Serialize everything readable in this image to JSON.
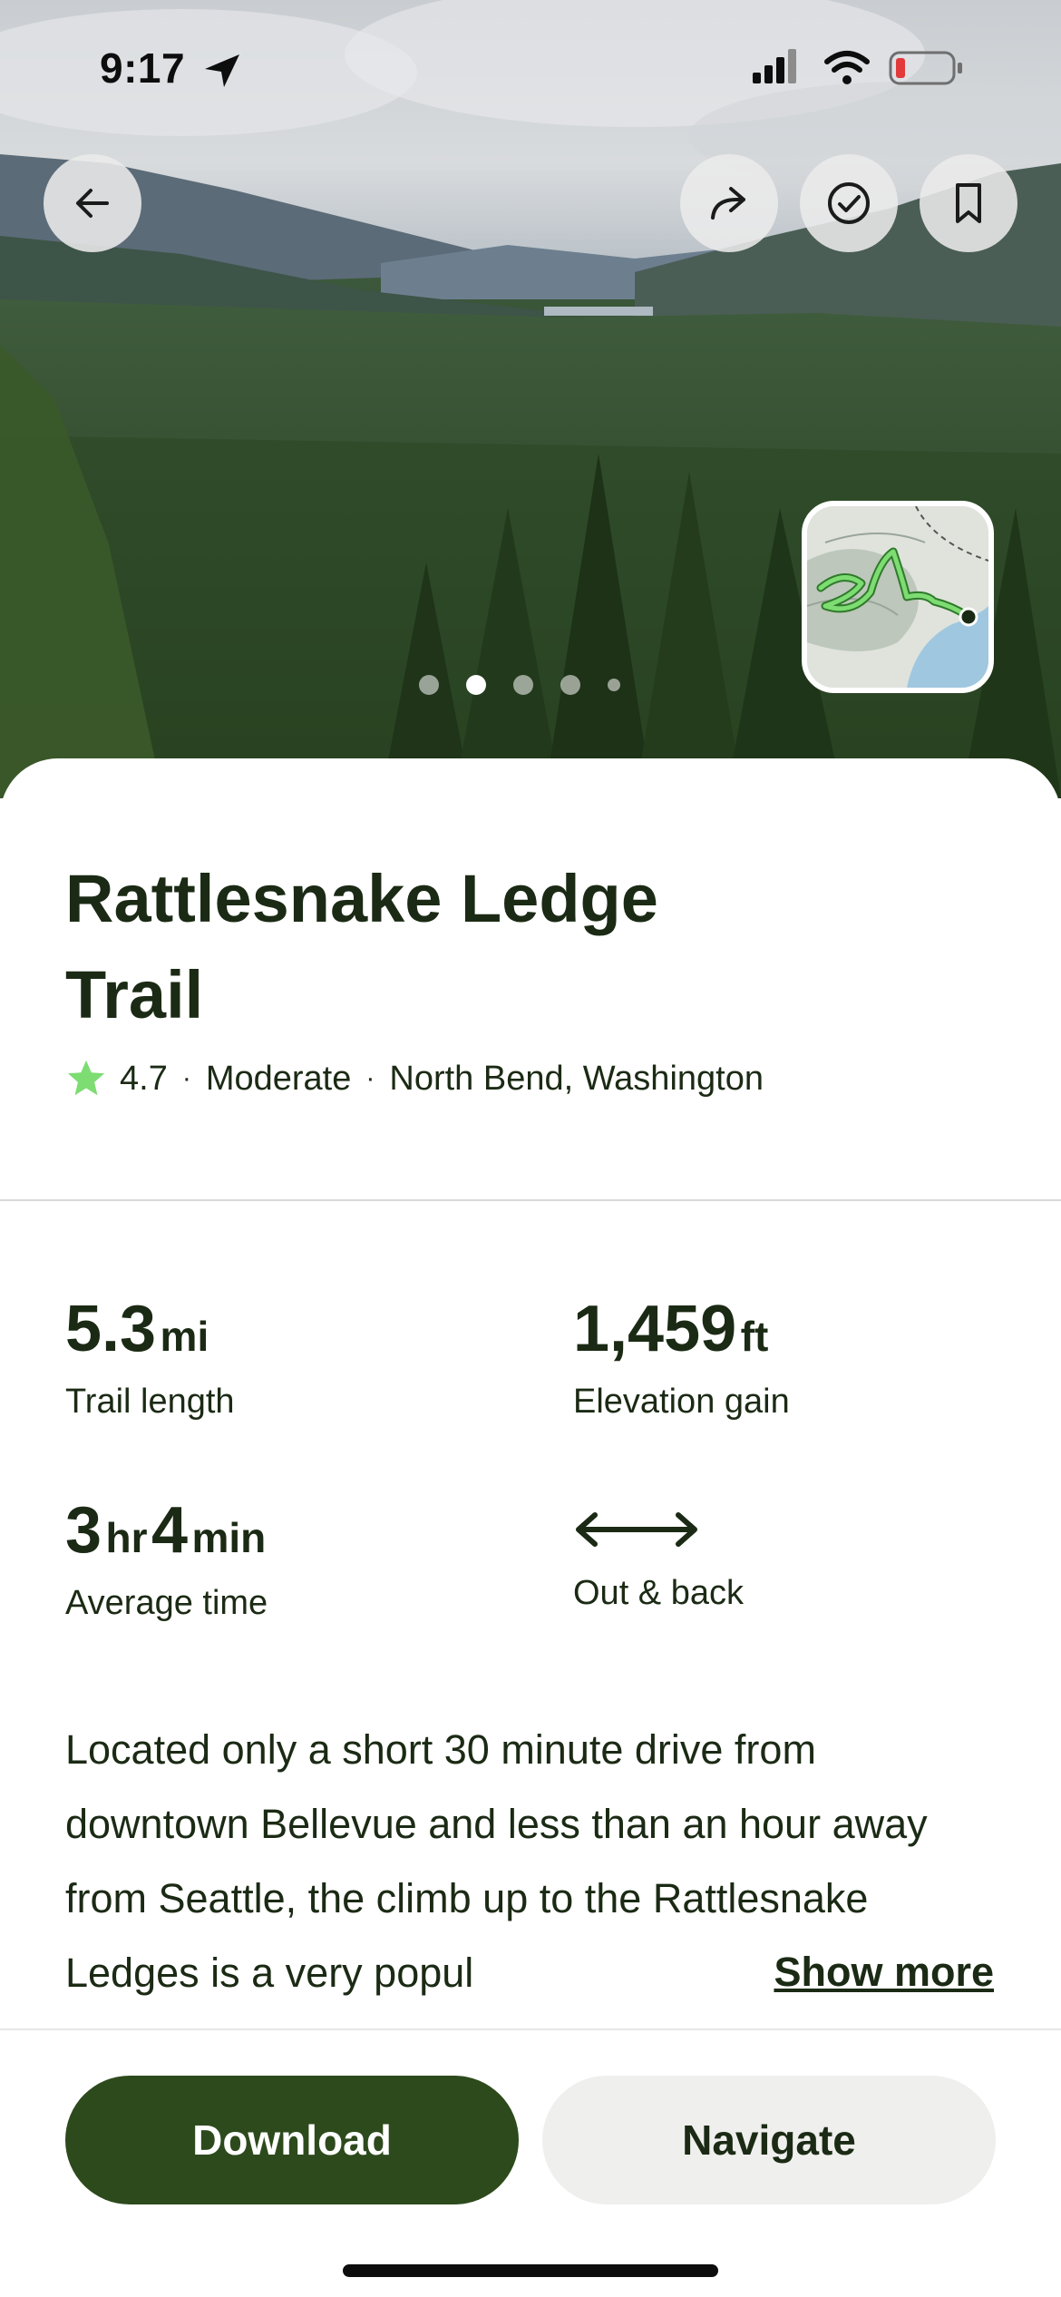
{
  "status_bar": {
    "time": "9:17"
  },
  "hero": {
    "buttons": {
      "back_icon": "arrow-left-icon",
      "share_icon": "share-icon",
      "completed_icon": "checkmark-circle-icon",
      "save_icon": "bookmark-icon"
    },
    "carousel": {
      "count": 5,
      "active_index": 1
    }
  },
  "trail": {
    "name": "Rattlesnake Ledge Trail",
    "rating": "4.7",
    "difficulty": "Moderate",
    "location": "North Bend, Washington",
    "separator": "·"
  },
  "stats": {
    "length_value": "5.3",
    "length_unit": "mi",
    "length_label": "Trail length",
    "elevation_value": "1,459",
    "elevation_unit": "ft",
    "elevation_label": "Elevation gain",
    "time_hours": "3",
    "time_hours_unit": "hr",
    "time_minutes": "4",
    "time_minutes_unit": "min",
    "time_label": "Average time",
    "route_icon": "double-arrow-icon",
    "route_label": "Out & back"
  },
  "description": {
    "text": "Located only a short 30 minute drive from downtown Bellevue and less than an hour away from Seattle, the climb up to the Rattlesnake Ledges is a very popul",
    "show_more": "Show more"
  },
  "actions": {
    "download": "Download",
    "navigate": "Navigate"
  },
  "colors": {
    "primary": "#2d4a1c",
    "text": "#1b2a14",
    "star": "#7ddc72",
    "secondary_button": "#efefed"
  }
}
